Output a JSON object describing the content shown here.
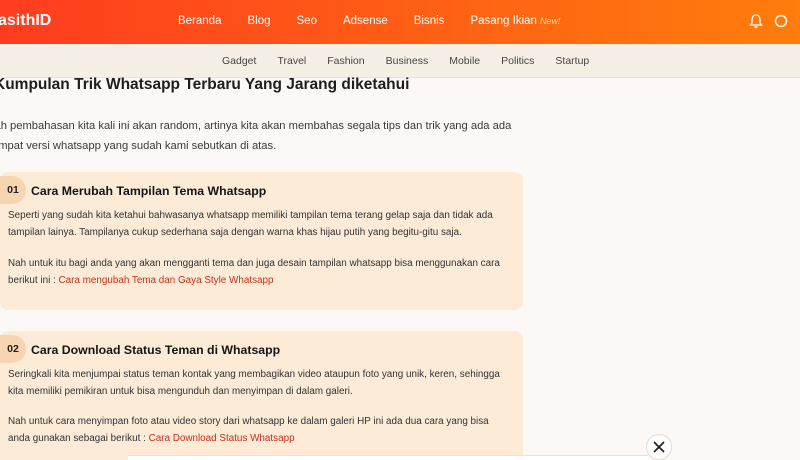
{
  "header": {
    "logo": "asithID",
    "nav": [
      {
        "label": "Beranda"
      },
      {
        "label": "Blog"
      },
      {
        "label": "Seo"
      },
      {
        "label": "Adsense"
      },
      {
        "label": "Bisnis"
      },
      {
        "label": "Pasang Ikian",
        "badge": "New!"
      }
    ],
    "icons": [
      "bell-icon",
      "search-icon"
    ]
  },
  "categories": [
    "Gadget",
    "Travel",
    "Fashion",
    "Business",
    "Mobile",
    "Politics",
    "Startup"
  ],
  "article": {
    "title": "Kumpulan Trik Whatsapp Terbaru Yang Jarang diketahui",
    "intro": "lah pembahasan kita kali ini akan random, artinya kita akan membahas segala tips dan trik yang ada ada empat versi whatsapp yang sudah kami sebutkan di atas."
  },
  "cards": [
    {
      "num": "01",
      "title": "Cara Merubah Tampilan Tema Whatsapp",
      "p1": "Seperti yang sudah kita ketahui bahwasanya whatsapp memiliki tampilan tema terang gelap saja dan tidak ada tampilan lainya. Tampilanya cukup sederhana saja dengan warna khas hijau putih yang begitu-gitu saja.",
      "p2_text": "Nah untuk itu bagi anda yang akan mengganti tema dan juga desain tampilan whatsapp bisa menggunakan cara berikut ini : ",
      "p2_link": "Cara mengubah Tema dan Gaya Style Whatsapp"
    },
    {
      "num": "02",
      "title": "Cara Download Status Teman di Whatsapp",
      "p1": "Seringkali kita menjumpai status teman kontak yang membagikan video ataupun foto yang unik, keren, sehingga kita memiliki pemikiran untuk bisa mengunduh dan menyimpan di dalam galeri.",
      "p2_text": "Nah untuk cara menyimpan foto atau video story dari whatsapp ke dalam galeri HP ini ada dua cara yang bisa anda gunakan sebagai berikut : ",
      "p2_link": "Cara Download Status Whatsapp"
    }
  ],
  "colors": {
    "header_start": "#ff3c1f",
    "header_end": "#ff7d0c",
    "subnav_bg": "#f6efe6",
    "card_bg": "#fbebd7",
    "link": "#c9301b"
  }
}
